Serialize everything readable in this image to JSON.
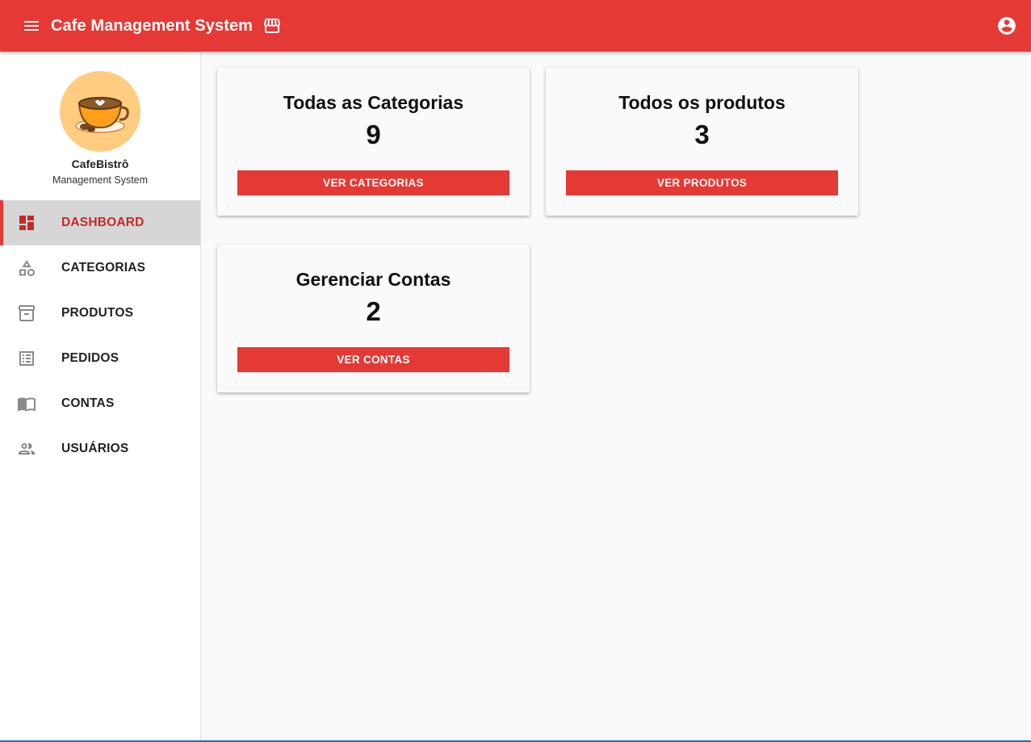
{
  "header": {
    "title": "Cafe Management System",
    "menu_icon": "menu-icon",
    "store_icon": "storefront-icon",
    "account_icon": "account-circle-icon"
  },
  "sidebar": {
    "brand_name": "CafeBistrô",
    "brand_subtitle": "Management System",
    "items": [
      {
        "label": "DASHBOARD",
        "icon": "dashboard-icon",
        "active": true
      },
      {
        "label": "CATEGORIAS",
        "icon": "category-icon",
        "active": false
      },
      {
        "label": "PRODUTOS",
        "icon": "inventory-icon",
        "active": false
      },
      {
        "label": "PEDIDOS",
        "icon": "list-alt-icon",
        "active": false
      },
      {
        "label": "CONTAS",
        "icon": "menu-book-icon",
        "active": false
      },
      {
        "label": "USUÁRIOS",
        "icon": "people-icon",
        "active": false
      }
    ]
  },
  "cards": [
    {
      "title": "Todas as Categorias",
      "count": "9",
      "button": "VER CATEGORIAS"
    },
    {
      "title": "Todos os produtos",
      "count": "3",
      "button": "VER PRODUTOS"
    },
    {
      "title": "Gerenciar Contas",
      "count": "2",
      "button": "VER CONTAS"
    }
  ],
  "colors": {
    "primary": "#e53935",
    "active_text": "#c62828",
    "active_bg": "#d6d6d6",
    "avatar_bg": "#ffcc80"
  }
}
